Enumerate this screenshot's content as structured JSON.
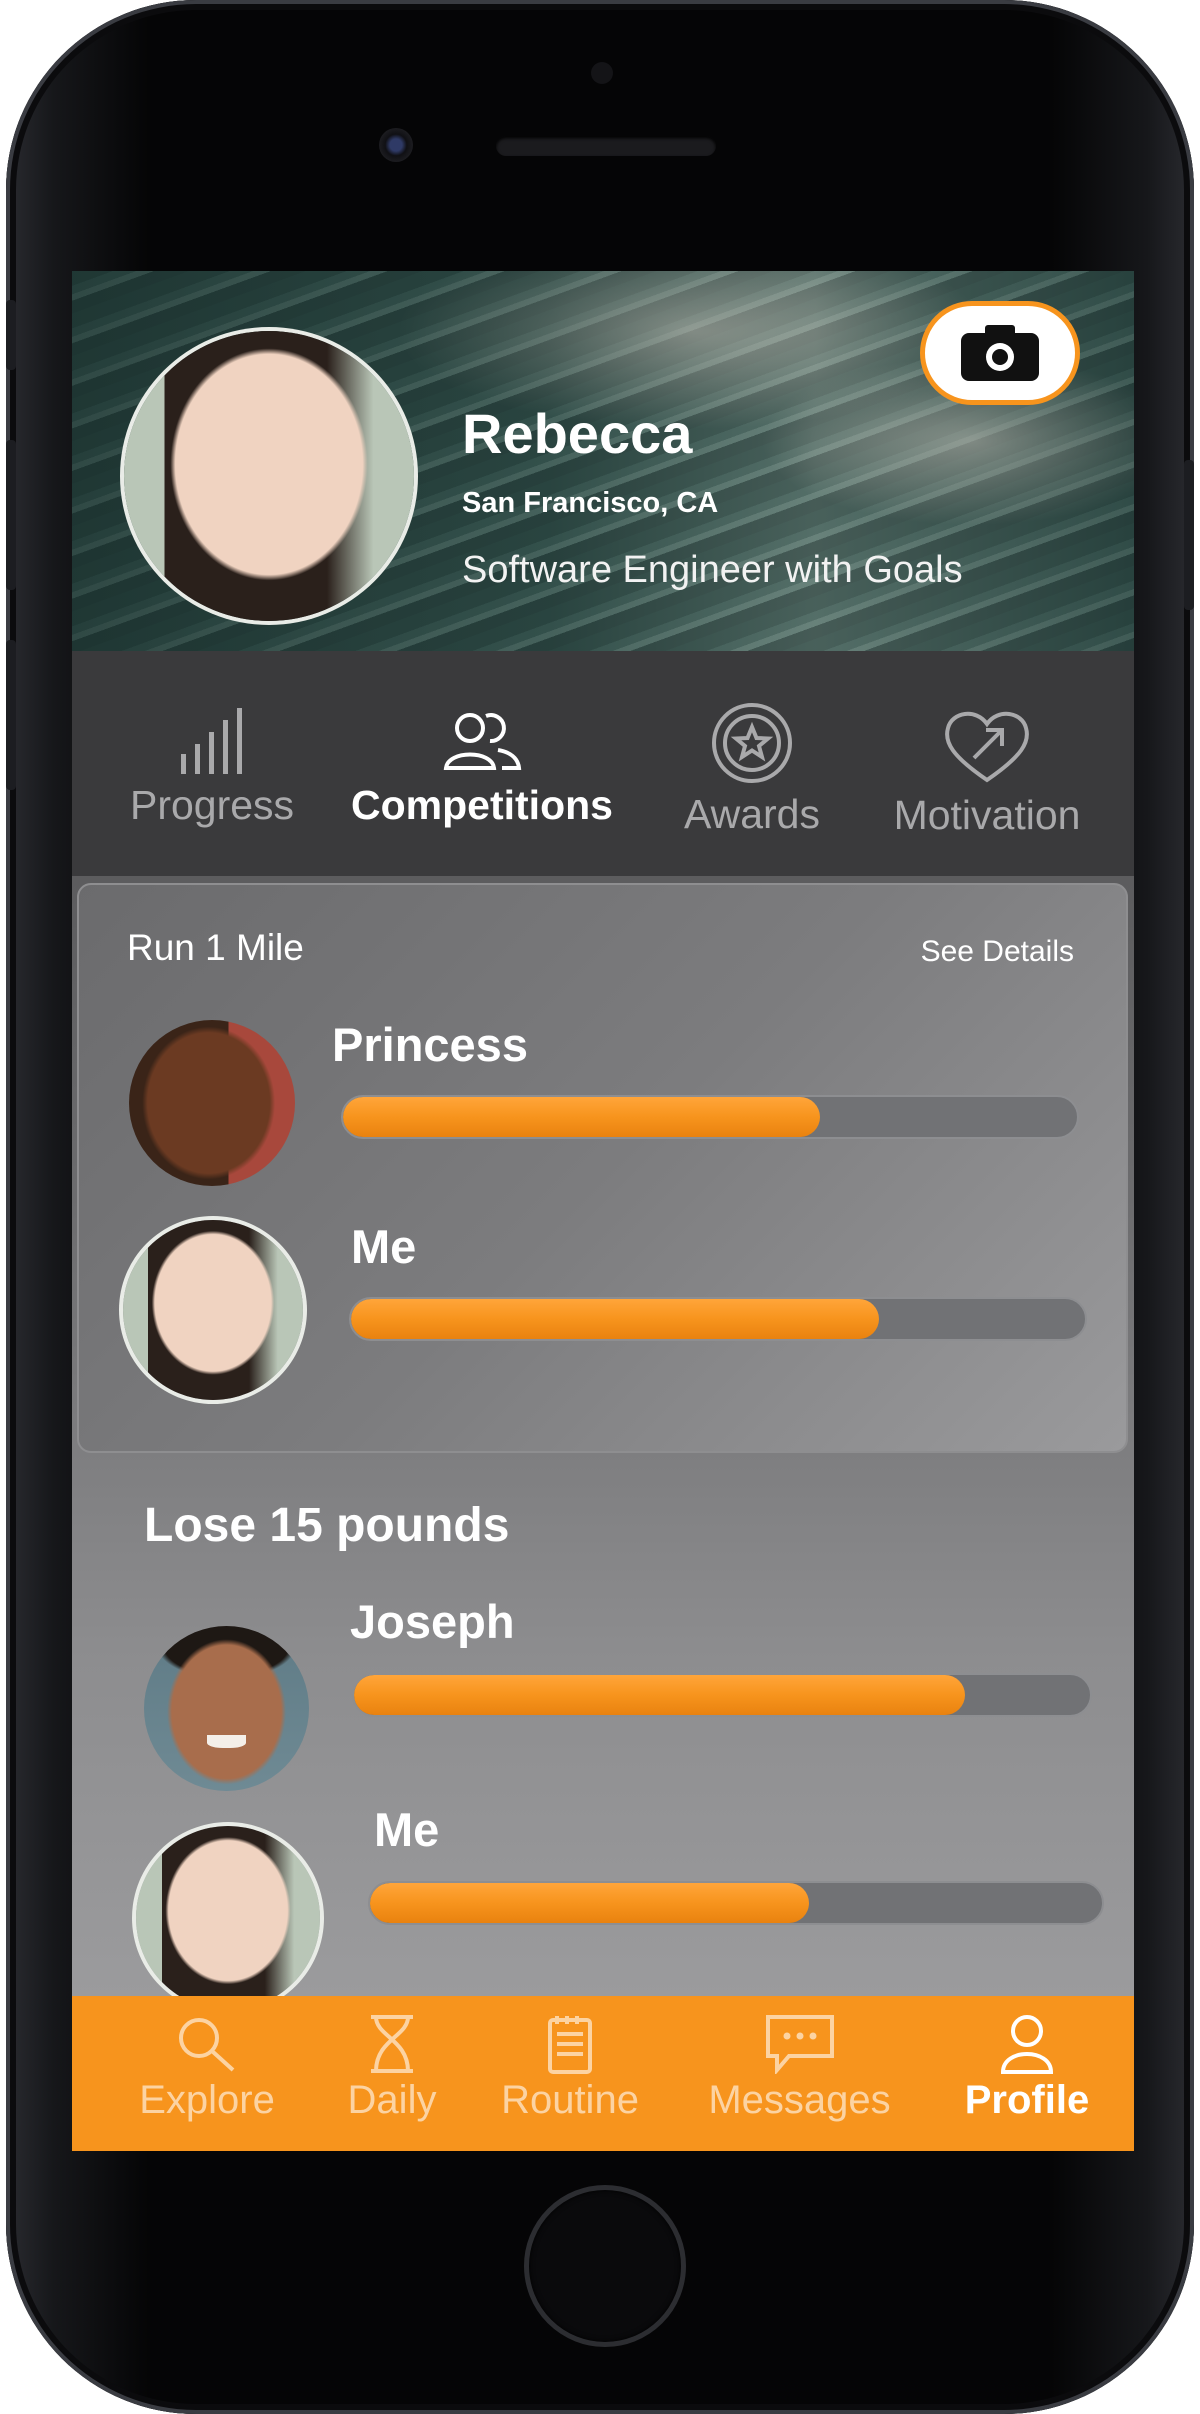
{
  "profile": {
    "name": "Rebecca",
    "location": "San Francisco, CA",
    "bio": "Software Engineer with Goals",
    "camera_icon": "camera-icon"
  },
  "tabs": [
    {
      "label": "Progress",
      "icon": "bar-chart-icon",
      "active": false
    },
    {
      "label": "Competitions",
      "icon": "users-icon",
      "active": true
    },
    {
      "label": "Awards",
      "icon": "star-badge-icon",
      "active": false
    },
    {
      "label": "Motivation",
      "icon": "heart-arrow-icon",
      "active": false
    }
  ],
  "competitions": [
    {
      "title": "Run 1 Mile",
      "details_link": "See Details",
      "participants": [
        {
          "name": "Princess",
          "progress": 0.65
        },
        {
          "name": "Me",
          "progress": 0.72
        }
      ]
    },
    {
      "title": "Lose 15 pounds",
      "participants": [
        {
          "name": "Joseph",
          "progress": 0.83
        },
        {
          "name": "Me",
          "progress": 0.6
        }
      ]
    }
  ],
  "nav": [
    {
      "label": "Explore",
      "icon": "search-icon",
      "active": false
    },
    {
      "label": "Daily",
      "icon": "hourglass-icon",
      "active": false
    },
    {
      "label": "Routine",
      "icon": "notepad-icon",
      "active": false
    },
    {
      "label": "Messages",
      "icon": "chat-bubble-icon",
      "active": false
    },
    {
      "label": "Profile",
      "icon": "person-icon",
      "active": true
    }
  ],
  "colors": {
    "accent": "#f7941d",
    "nav_inactive_text": "#fcd3a2",
    "tab_inactive_text": "#a9a9ab"
  }
}
